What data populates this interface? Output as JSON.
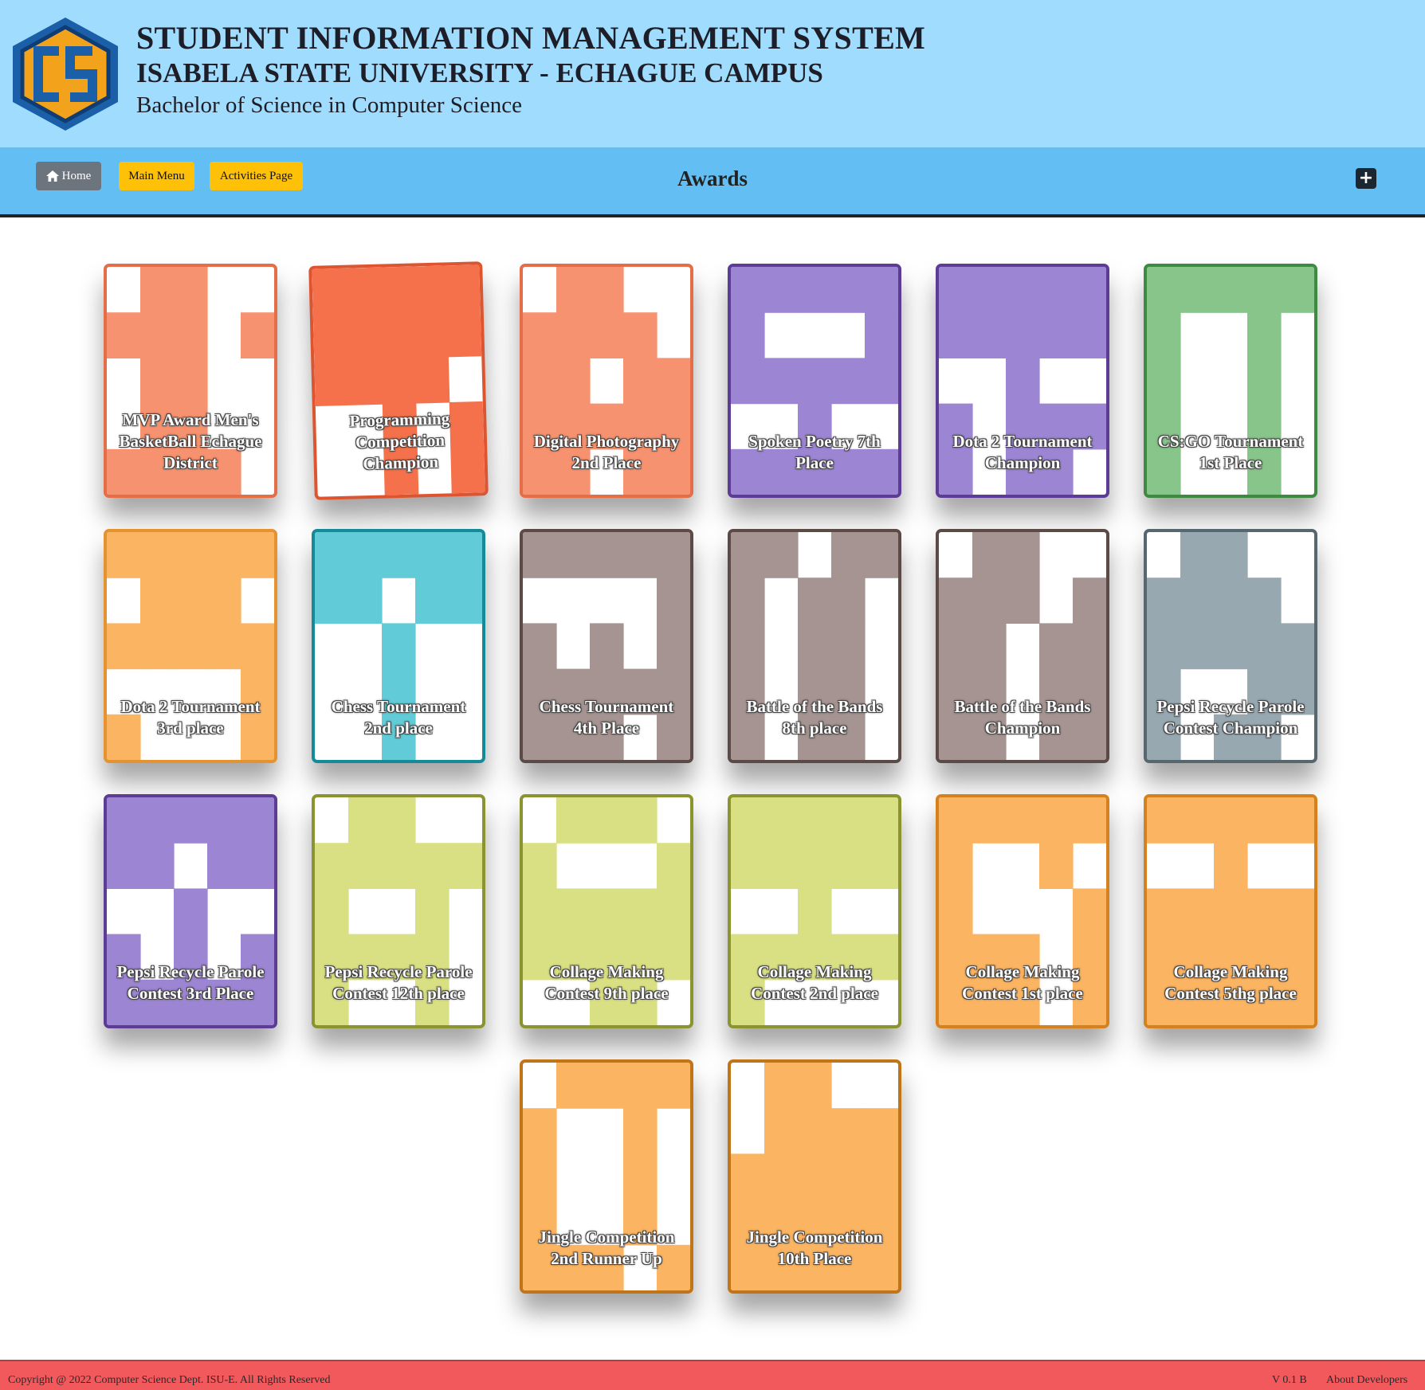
{
  "header": {
    "title": "STUDENT INFORMATION MANAGEMENT SYSTEM",
    "university": "ISABELA STATE UNIVERSITY - ECHAGUE CAMPUS",
    "course": "Bachelor of Science in Computer Science",
    "logo_icon": "cs-hexagon-logo-icon"
  },
  "nav": {
    "home_label": "Home",
    "main_menu_label": "Main Menu",
    "activities_label": "Activities Page",
    "page_title": "Awards",
    "add_icon": "plus-square-icon"
  },
  "awards": [
    {
      "label": "MVP Award Men's BasketBall Echague District",
      "color": "#f6926f",
      "border": "#e46e48"
    },
    {
      "label": "Programming Competition Champion",
      "color": "#f4714c",
      "border": "#dd5530"
    },
    {
      "label": "Digital Photography 2nd Place",
      "color": "#f6926f",
      "border": "#e46e48"
    },
    {
      "label": "Spoken Poetry 7th Place",
      "color": "#9c85d2",
      "border": "#5d3c95"
    },
    {
      "label": "Dota 2 Tournament Champion",
      "color": "#9c85d2",
      "border": "#5d3c95"
    },
    {
      "label": "CS:GO Tournament 1st Place",
      "color": "#88c58a",
      "border": "#3e8a42"
    },
    {
      "label": "Dota 2 Tournament 3rd place",
      "color": "#fbb462",
      "border": "#e59230"
    },
    {
      "label": "Chess Tournament 2nd place",
      "color": "#61ccd8",
      "border": "#158a98"
    },
    {
      "label": "Chess Tournament 4th Place",
      "color": "#a59491",
      "border": "#5b4a46"
    },
    {
      "label": "Battle of the Bands 8th place",
      "color": "#a59491",
      "border": "#5b4a46"
    },
    {
      "label": "Battle of the Bands Champion",
      "color": "#a59491",
      "border": "#5b4a46"
    },
    {
      "label": "Pepsi Recycle Parole Contest Champion",
      "color": "#97a8b1",
      "border": "#56676f"
    },
    {
      "label": "Pepsi Recycle Parole Contest 3rd Place",
      "color": "#9c85d2",
      "border": "#5d3c95"
    },
    {
      "label": "Pepsi Recycle Parole Contest 12th place",
      "color": "#d9e083",
      "border": "#8c942f"
    },
    {
      "label": "Collage Making Contest 9th place",
      "color": "#d9e083",
      "border": "#8c942f"
    },
    {
      "label": "Collage Making Contest 2nd place",
      "color": "#d9e083",
      "border": "#8c942f"
    },
    {
      "label": "Collage Making Contest 1st place",
      "color": "#fbb462",
      "border": "#d5821e"
    },
    {
      "label": "Collage Making Contest 5thg place",
      "color": "#fbb462",
      "border": "#d5821e"
    },
    {
      "label": "Jingle Competition 2nd Runner Up",
      "color": "#fbb462",
      "border": "#c27418"
    },
    {
      "label": "Jingle Competition 10th Place",
      "color": "#fbb462",
      "border": "#c27418"
    }
  ],
  "footer": {
    "copyright": "Copyright @ 2022 Computer Science Dept. ISU-E. All Rights Reserved",
    "version": "V 0.1 B",
    "about": "About Developers"
  }
}
